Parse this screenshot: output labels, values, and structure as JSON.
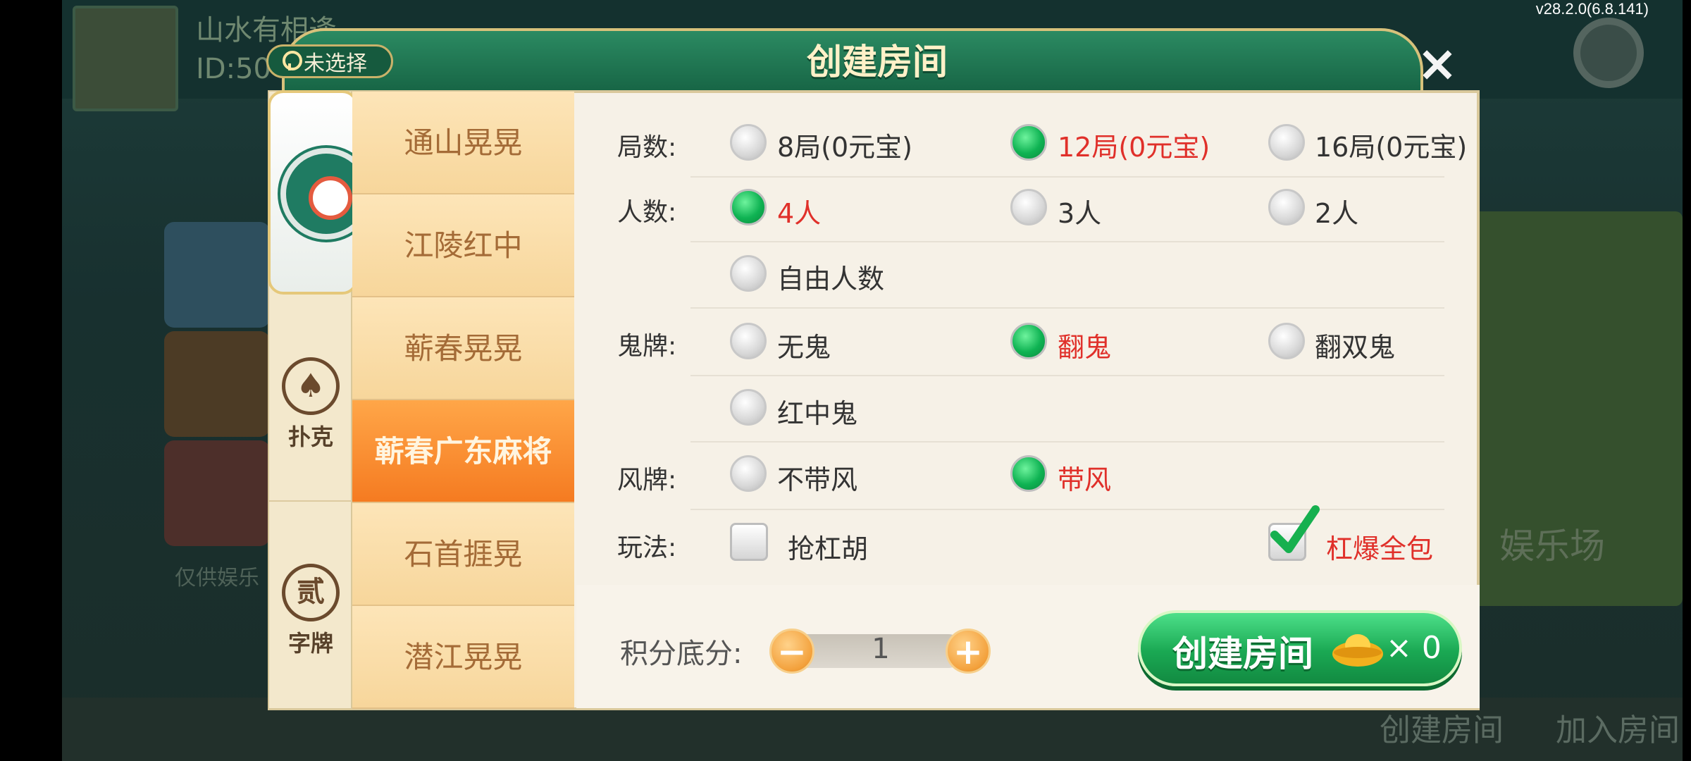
{
  "version": "v28.2.0(6.8.141)",
  "background": {
    "player_name": "山水有相逢",
    "player_id": "ID:50",
    "bottom_create": "创建房间",
    "bottom_join": "加入房间",
    "left_text": "仅供娱乐",
    "right_text": "娱乐场"
  },
  "dialog": {
    "title": "创建房间",
    "location": "未选择",
    "categories": [
      {
        "label": "",
        "icon": "mahjong-emblem-icon",
        "selected": true
      },
      {
        "label": "扑克",
        "icon": "spade-icon",
        "glyph": "♠"
      },
      {
        "label": "字牌",
        "icon": "character-tile-icon",
        "glyph": "贰"
      }
    ],
    "games": [
      "通山晃晃",
      "江陵红中",
      "蕲春晃晃",
      "蕲春广东麻将",
      "石首捱晃",
      "潜江晃晃"
    ],
    "active_game": "蕲春广东麻将",
    "rows": {
      "rounds": {
        "label": "局数:",
        "options": [
          "8局(0元宝)",
          "12局(0元宝)",
          "16局(0元宝)"
        ],
        "selected": "12局(0元宝)"
      },
      "players": {
        "label": "人数:",
        "options": [
          "4人",
          "3人",
          "2人",
          "自由人数"
        ],
        "selected": "4人"
      },
      "ghost": {
        "label": "鬼牌:",
        "options": [
          "无鬼",
          "翻鬼",
          "翻双鬼",
          "红中鬼"
        ],
        "selected": "翻鬼"
      },
      "wind": {
        "label": "风牌:",
        "options": [
          "不带风",
          "带风"
        ],
        "selected": "带风"
      },
      "play": {
        "label": "玩法:",
        "options": [
          "抢杠胡",
          "杠爆全包"
        ],
        "checked": [
          "杠爆全包"
        ]
      }
    },
    "score": {
      "label": "积分底分:",
      "value": "1",
      "minus": "−",
      "plus": "+"
    },
    "create_button": {
      "label": "创建房间",
      "cost": "× 0"
    },
    "close": "×"
  },
  "colors": {
    "accent_green": "#1aa853",
    "selected_red": "#e0302a",
    "active_tab_orange": "#f57b21",
    "header_green": "#176545"
  }
}
